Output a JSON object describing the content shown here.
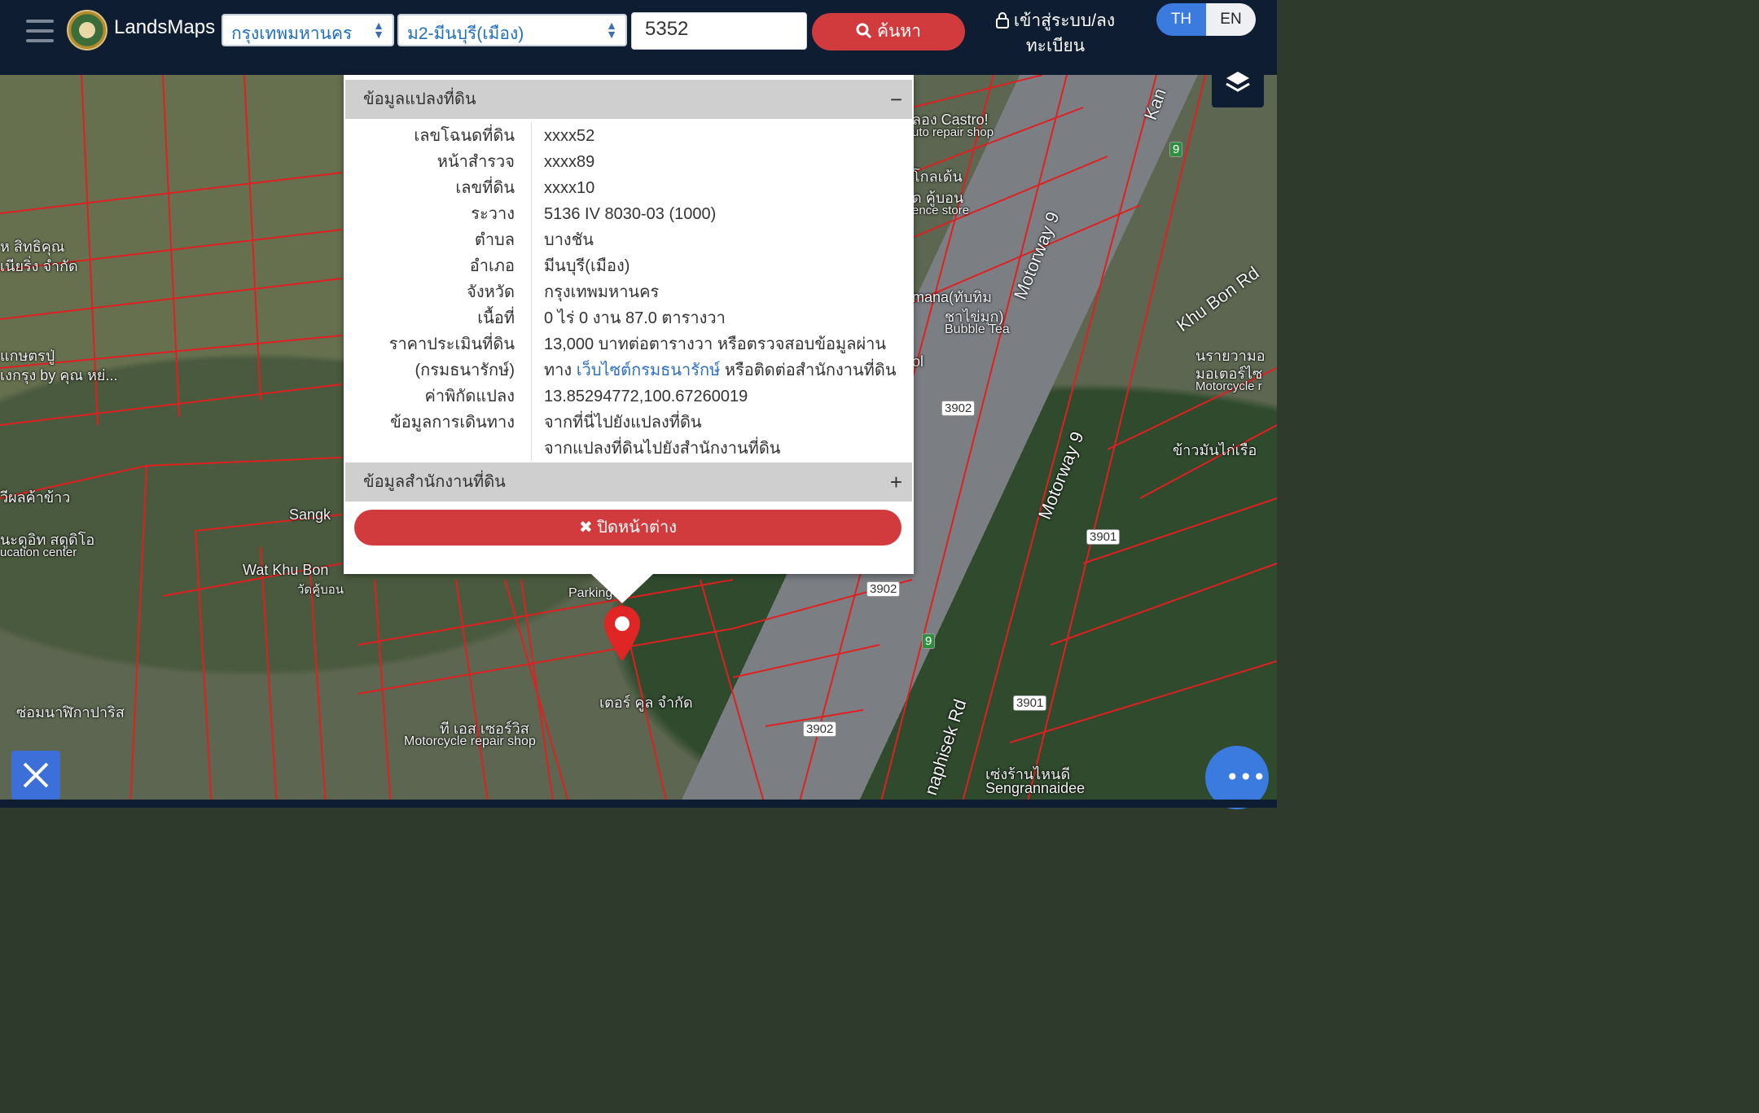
{
  "header": {
    "brand": "LandsMaps",
    "province_select": "กรุงเทพมหานคร",
    "district_select": "ม2-มีนบุรี(เมือง)",
    "search_value": "5352",
    "search_button": "ค้นหา",
    "login_line1": "เข้าสู่ระบบ/ลง",
    "login_line2": "ทะเบียน",
    "lang_th": "TH",
    "lang_en": "EN"
  },
  "popup": {
    "section1_title": "ข้อมูลแปลงที่ดิน",
    "section1_toggle": "−",
    "rows": [
      {
        "label": "เลขโฉนดที่ดิน",
        "value": "xxxx52"
      },
      {
        "label": "หน้าสำรวจ",
        "value": "xxxx89"
      },
      {
        "label": "เลขที่ดิน",
        "value": "xxxx10"
      },
      {
        "label": "ระวาง",
        "value": "5136 IV 8030-03 (1000)"
      },
      {
        "label": "ตำบล",
        "value": "บางชัน"
      },
      {
        "label": "อำเภอ",
        "value": "มีนบุรี(เมือง)"
      },
      {
        "label": "จังหวัด",
        "value": "กรุงเทพมหานคร"
      },
      {
        "label": "เนื้อที่",
        "value": "0 ไร่ 0 งาน 87.0 ตารางวา"
      }
    ],
    "price_label_1": "ราคาประเมินที่ดิน",
    "price_label_2": "(กรมธนารักษ์)",
    "price_value_1": "13,000 บาทต่อตารางวา หรือตรวจสอบข้อมูลผ่าน",
    "price_value_2a": "ทาง ",
    "price_link": "เว็บไซต์กรมธนารักษ์",
    "price_value_2b": " หรือติดต่อสำนักงานที่ดิน",
    "coord_label": "ค่าพิกัดแปลง",
    "coord_value": "13.85294772,100.67260019",
    "route_label": "ข้อมูลการเดินทาง",
    "route_link_1": "จากที่นี่ไปยังแปลงที่ดิน",
    "route_link_2": "จากแปลงที่ดินไปยังสำนักงานที่ดิน",
    "section2_title": "ข้อมูลสำนักงานที่ดิน",
    "section2_toggle": "+",
    "close_button": "ปิดหน้าต่าง"
  },
  "map_labels": {
    "castro": "ลอง Castro!",
    "castro_sub": "uto repair shop",
    "kotkaden": "โกลเด้น",
    "khubon": "ด คู้บอน",
    "store": "ence store",
    "mana": "mana(ทับทิม",
    "mana2": "ชาไข่มุก)",
    "bubble": "Bubble Tea",
    "sittikun": "ห สิทธิคุณ",
    "sittikun2": "เนียริ่ง จำกัด",
    "kaset": "แกษตรปู่",
    "kaset2": "เงกรุง by คุณ หย่...",
    "rice": "วีผลค้าข้าว",
    "sangk": "Sangk",
    "watkhubon": "Wat Khu Bon",
    "watkhubon2": "วัดคู้บอน",
    "edu": "นะดูอิท สดูดิโอ",
    "edu2": "ucation center",
    "motor": "ซ่อมนาฬิกาปาริส",
    "ts": "ที เอส เซอร์วิส",
    "ts2": "Motorcycle repair shop",
    "parking": "Parking lot",
    "ter": "เตอร์ คูล จำกัด",
    "motorway1": "Motorway 9",
    "motorway2": "Motorway 9",
    "khubonrd": "Khu Bon Rd",
    "kan": "Kan",
    "ramintra": "นรายวามอ",
    "ramintra2": "มอเตอร์ไซ",
    "ramintra3": "Motorcycle r",
    "khaoman": "ข้าวมันไก่เรือ",
    "phisek": "naphisek Rd",
    "seng": "เซ่งร้านไหนดี",
    "seng2": "Sengrannaidee",
    "ol": "ol",
    "badge_3902a": "3902",
    "badge_3902b": "3902",
    "badge_3902c": "3902",
    "badge_3901a": "3901",
    "badge_3901b": "3901",
    "badge_9a": "9",
    "badge_9b": "9"
  },
  "colors": {
    "header_bg": "#0f1d33",
    "primary_red": "#d13b3e",
    "link_blue": "#2f6fc0",
    "lang_active": "#3b7be0",
    "parcel_line": "#e02020"
  },
  "icons": {
    "hamburger": "menu-icon",
    "search": "search-icon",
    "lock": "lock-icon",
    "layers": "layers-icon",
    "close": "close-icon",
    "pin": "map-pin-icon",
    "tools": "measure-tools-icon",
    "more": "more-dots-icon"
  }
}
